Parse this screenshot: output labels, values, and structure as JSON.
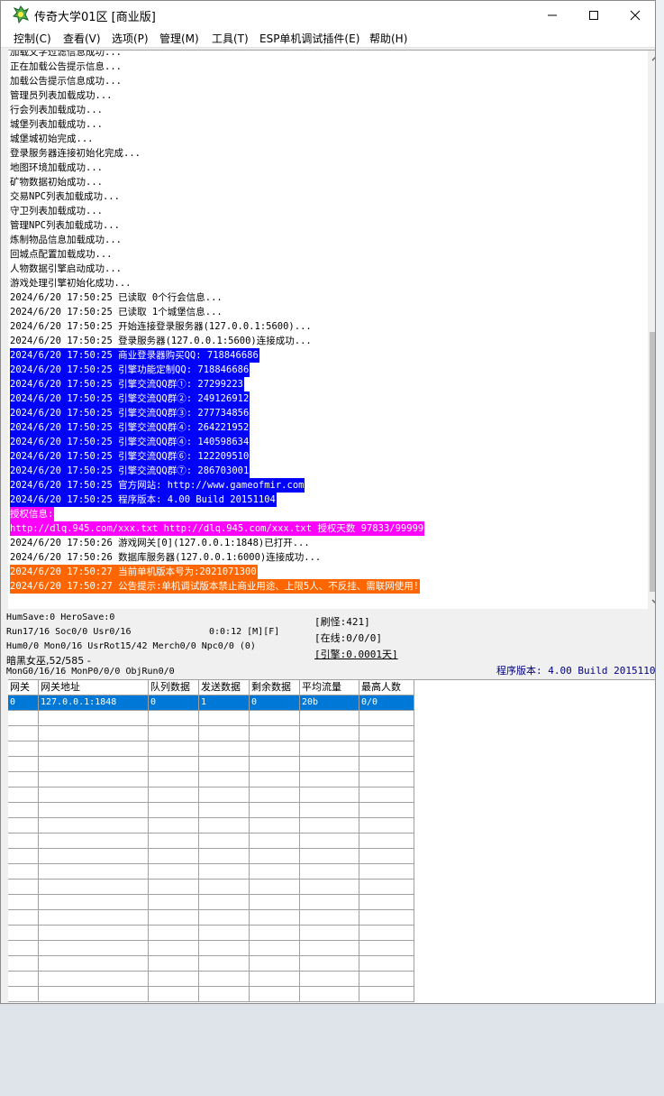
{
  "window": {
    "title": "传奇大学01区 [商业版]"
  },
  "menu": [
    {
      "label": "控制(C)"
    },
    {
      "label": "查看(V)"
    },
    {
      "label": "选项(P)"
    },
    {
      "label": "管理(M)"
    },
    {
      "label": "工具(T)"
    },
    {
      "label": "ESP单机调试插件(E)"
    },
    {
      "label": "帮助(H)"
    }
  ],
  "log_lines": [
    {
      "text": "加载文字过滤信息成功...",
      "style": "plain"
    },
    {
      "text": "正在加载公告提示信息...",
      "style": "plain"
    },
    {
      "text": "加载公告提示信息成功...",
      "style": "plain"
    },
    {
      "text": "管理员列表加载成功...",
      "style": "plain"
    },
    {
      "text": "行会列表加载成功...",
      "style": "plain"
    },
    {
      "text": "城堡列表加载成功...",
      "style": "plain"
    },
    {
      "text": "城堡城初始完成...",
      "style": "plain"
    },
    {
      "text": "登录服务器连接初始化完成...",
      "style": "plain"
    },
    {
      "text": "地图环境加载成功...",
      "style": "plain"
    },
    {
      "text": "矿物数据初始成功...",
      "style": "plain"
    },
    {
      "text": "交易NPC列表加载成功...",
      "style": "plain"
    },
    {
      "text": "守卫列表加载成功...",
      "style": "plain"
    },
    {
      "text": "管理NPC列表加载成功...",
      "style": "plain"
    },
    {
      "text": "炼制物品信息加载成功...",
      "style": "plain"
    },
    {
      "text": "回城点配置加载成功...",
      "style": "plain"
    },
    {
      "text": "人物数据引擎启动成功...",
      "style": "plain"
    },
    {
      "text": "游戏处理引擎初始化成功...",
      "style": "plain"
    },
    {
      "text": "2024/6/20 17:50:25 已读取 0个行会信息...",
      "style": "plain"
    },
    {
      "text": "2024/6/20 17:50:25 已读取 1个城堡信息...",
      "style": "plain"
    },
    {
      "text": "2024/6/20 17:50:25 开始连接登录服务器(127.0.0.1:5600)...",
      "style": "plain"
    },
    {
      "text": "2024/6/20 17:50:25 登录服务器(127.0.0.1:5600)连接成功...",
      "style": "plain"
    },
    {
      "text": "2024/6/20 17:50:25 商业登录器购买QQ: 718846686",
      "style": "blue"
    },
    {
      "text": "2024/6/20 17:50:25 引擎功能定制QQ: 718846686",
      "style": "blue"
    },
    {
      "text": "2024/6/20 17:50:25 引擎交流QQ群①: 27299223",
      "style": "blue"
    },
    {
      "text": "2024/6/20 17:50:25 引擎交流QQ群②: 249126912",
      "style": "blue"
    },
    {
      "text": "2024/6/20 17:50:25 引擎交流QQ群③: 277734856",
      "style": "blue"
    },
    {
      "text": "2024/6/20 17:50:25 引擎交流QQ群④: 264221952",
      "style": "blue"
    },
    {
      "text": "2024/6/20 17:50:25 引擎交流QQ群④: 140598634",
      "style": "blue"
    },
    {
      "text": "2024/6/20 17:50:25 引擎交流QQ群⑥: 122209510",
      "style": "blue"
    },
    {
      "text": "2024/6/20 17:50:25 引擎交流QQ群⑦: 286703001",
      "style": "blue"
    },
    {
      "text": "2024/6/20 17:50:25 官方网站: http://www.gameofmir.com",
      "style": "blue"
    },
    {
      "text": "2024/6/20 17:50:25 程序版本: 4.00 Build 20151104",
      "style": "blue"
    },
    {
      "text": "授权信息:",
      "style": "magenta"
    },
    {
      "text": "http://dlq.945.com/xxx.txt http://dlq.945.com/xxx.txt 授权天数 97833/99999",
      "style": "magenta"
    },
    {
      "text": "2024/6/20 17:50:26 游戏网关[0](127.0.0.1:1848)已打开...",
      "style": "plain"
    },
    {
      "text": "2024/6/20 17:50:26 数据库服务器(127.0.0.1:6000)连接成功...",
      "style": "plain"
    },
    {
      "text": "2024/6/20 17:50:27 当前单机版本号为:2021071300",
      "style": "orange"
    },
    {
      "text": "2024/6/20 17:50:27 公告提示:单机调试版本禁止商业用途、上限5人、不反挂、需联网使用!",
      "style": "orange"
    }
  ],
  "status": {
    "line1": "HumSave:0 HeroSave:0",
    "line2": "Run17/16 Soc0/0 Usr0/16",
    "time": "0:0:12 [M][F]",
    "line3": "Hum0/0 Mon0/16 UsrRot15/42 Merch0/0 Npc0/0 (0)",
    "line4": "暗黑女巫,52/585 -",
    "line5": "MonG0/16/16 MonP0/0/0 ObjRun0/0",
    "refresh": "[刷怪:421]",
    "online": "[在线:0/0/0]",
    "engine": "[引擎:0.0001天]",
    "version": "程序版本: 4.00 Build 20151104"
  },
  "gateway_table": {
    "headers": [
      "网关",
      "网关地址",
      "队列数据",
      "发送数据",
      "剩余数据",
      "平均流量",
      "最高人数"
    ],
    "rows": [
      [
        "0",
        "127.0.0.1:1848",
        "0",
        "1",
        "0",
        "20b",
        "0/0"
      ]
    ]
  },
  "colors": {
    "highlight_blue": "#0000ff",
    "highlight_magenta": "#ff00ff",
    "highlight_orange": "#ff6600",
    "selection": "#0078d7"
  }
}
